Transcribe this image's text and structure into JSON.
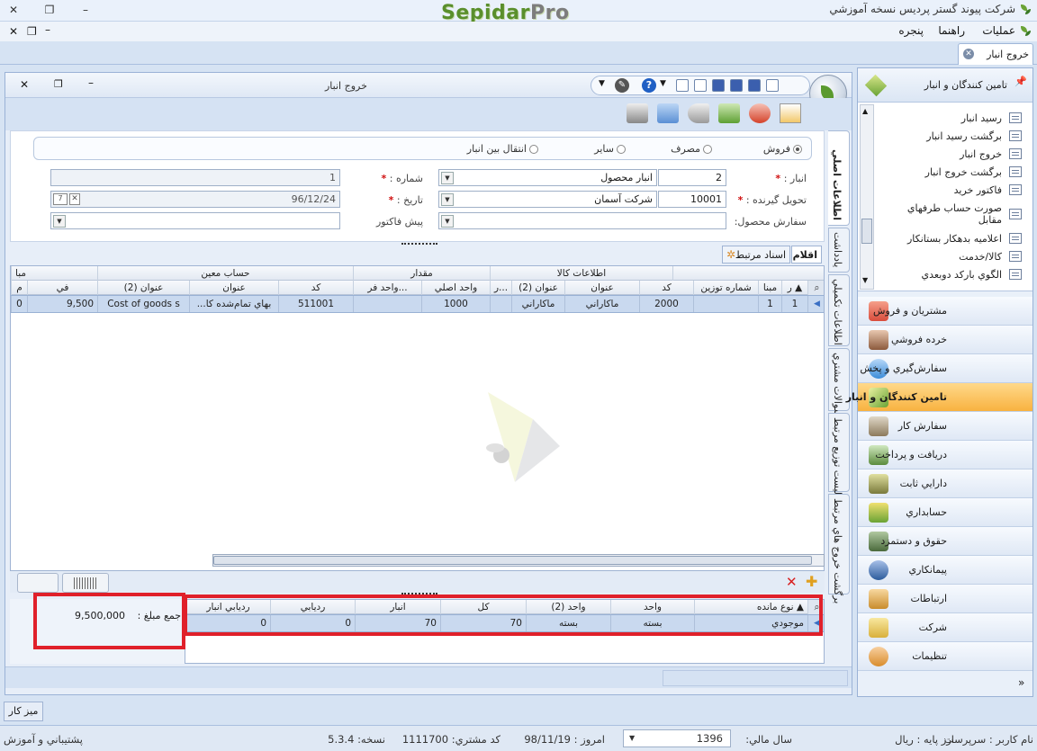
{
  "app": {
    "brand_main": "Sepidar",
    "brand_suffix": "Pro",
    "company": "شرکت پیوند گستر پردیس نسخه آموزشي"
  },
  "menu": [
    "عمليات",
    "راهنما",
    "پنجره"
  ],
  "doc_tab": "خروج انبار",
  "window": {
    "title": "خروج انبار"
  },
  "form": {
    "radios": [
      {
        "label": "فروش",
        "checked": true
      },
      {
        "label": "مصرف",
        "checked": false
      },
      {
        "label": "ساير",
        "checked": false
      },
      {
        "label": "انتقال بين انبار",
        "checked": false
      }
    ],
    "warehouse_label": "انبار :",
    "warehouse_code": "2",
    "warehouse_name": "انبار محصول",
    "number_label": "شماره :",
    "number_value": "1",
    "receiver_label": "تحويل گيرنده :",
    "receiver_code": "10001",
    "receiver_name": "شرکت آسمان",
    "date_label": "تاريخ :",
    "date_value": "96/12/24",
    "order_label": "سفارش محصول:",
    "proforma_label": "پيش فاکتور"
  },
  "side_tabs": [
    "اطلاعات اصلي",
    "يادداشت",
    "اطلاعات تکميلي",
    "سوالات مشتري",
    "ليست توزيع مرتبط",
    "برگشت خروج هاي مرتبط"
  ],
  "sub_tabs": {
    "items": "اقلام",
    "related": "اسناد مرتبط"
  },
  "grid": {
    "groups": {
      "goods_info": "اطلاعات کالا",
      "quantity": "مقدار",
      "account": "حساب معين",
      "last": "مبا"
    },
    "columns": {
      "row": "ر",
      "base": "مبنا",
      "weigh_no": "شماره توزين",
      "code": "کد",
      "title": "عنوان",
      "title2": "عنوان (2)",
      "r": "ر...",
      "main_unit": "واحد اصلي",
      "sub_unit": "واحد فر...",
      "acc_code": "کد",
      "acc_title": "عنوان",
      "acc_title2": "عنوان (2)",
      "fee": "في",
      "m": "م"
    },
    "rows": [
      {
        "row": "1",
        "base": "1",
        "weigh_no": "",
        "code": "2000",
        "title": "ماکاراني",
        "title2": "ماکاراني",
        "r": "",
        "main_unit": "1000",
        "sub_unit": "",
        "acc_code": "511001",
        "acc_title": "بهاي تمام‌شده کا...",
        "acc_title2": "Cost of goods s",
        "fee": "9,500",
        "m": "0"
      }
    ]
  },
  "stock_grid": {
    "columns": {
      "type": "نوع مانده",
      "unit": "واحد",
      "unit2": "واحد (2)",
      "total": "کل",
      "warehouse": "انبار",
      "tracking": "رديابي",
      "wh_tracking": "رديابي انبار"
    },
    "rows": [
      {
        "type": "موجودي",
        "unit": "بسته",
        "unit2": "بسته",
        "total": "70",
        "warehouse": "70",
        "tracking": "0",
        "wh_tracking": "0"
      }
    ]
  },
  "summary": {
    "label": "جمع مبلغ :",
    "value": "9,500,000"
  },
  "nav": {
    "header": "تامين کنندگان و انبار",
    "tree": [
      "رسيد انبار",
      "برگشت رسيد انبار",
      "خروج انبار",
      "برگشت خروج انبار",
      "فاکتور خريد",
      "صورت حساب طرفهاي مقابل",
      "اعلاميه بدهکار بستانکار",
      "کالا/خدمت",
      "الگوي بارکد دوبعدي"
    ],
    "buttons": [
      {
        "label": "مشتريان و فروش",
        "color": "#d94c3c"
      },
      {
        "label": "خرده فروشي",
        "color": "#8c5a3c"
      },
      {
        "label": "سفارش‌گيري و پخش",
        "color": "#3c8cd9"
      },
      {
        "label": "تامين کنندگان و انبار",
        "color": "#d9a03c",
        "active": true
      },
      {
        "label": "سفارش کار",
        "color": "#8c7a5c"
      },
      {
        "label": "دريافت و پرداخت",
        "color": "#5c8c3c"
      },
      {
        "label": "دارايي ثابت",
        "color": "#7a7a3c"
      },
      {
        "label": "حسابداري",
        "color": "#6aa335"
      },
      {
        "label": "حقوق و دستمزد",
        "color": "#4a6a3c"
      },
      {
        "label": "پيمانکاري",
        "color": "#2c5c9c"
      },
      {
        "label": "ارتباطات",
        "color": "#c98c2c"
      },
      {
        "label": "شرکت",
        "color": "#d9b03c"
      },
      {
        "label": "تنظيمات",
        "color": "#d98c2c"
      }
    ]
  },
  "desk": "ميز کار",
  "status": {
    "user_label": "نام کاربر :",
    "user_value": "سرپرست",
    "base_cur_label": "ارز پايه :",
    "base_cur_value": "ريال",
    "fiscal_label": "سال مالي:",
    "fiscal_value": "1396",
    "today_label": "امروز :",
    "today_value": "98/11/19",
    "customer_label": "کد مشتري:",
    "customer_value": "1111700",
    "version_label": "نسخه:",
    "version_value": "5.3.4",
    "support": "پشتيباني و آموزش"
  }
}
